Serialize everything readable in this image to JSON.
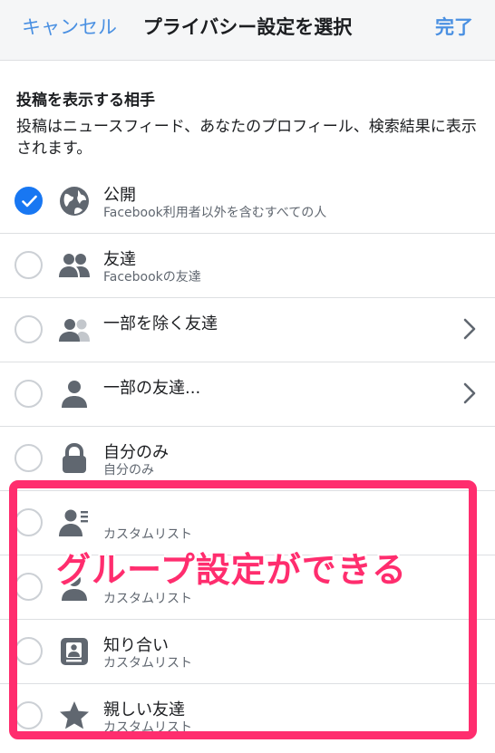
{
  "header": {
    "cancel_label": "キャンセル",
    "title": "プライバシー設定を選択",
    "done_label": "完了"
  },
  "section": {
    "title": "投稿を表示する相手",
    "description": "投稿はニュースフィード、あなたのプロフィール、検索結果に表示されます。"
  },
  "options": [
    {
      "label": "公開",
      "sub": "Facebook利用者以外を含むすべての人",
      "icon": "globe-icon",
      "checked": true
    },
    {
      "label": "友達",
      "sub": "Facebookの友達",
      "icon": "friends-icon",
      "checked": false
    },
    {
      "label": "一部を除く友達",
      "sub": "",
      "icon": "friends-except-icon",
      "checked": false,
      "chevron": true
    },
    {
      "label": "一部の友達...",
      "sub": "",
      "icon": "person-icon",
      "checked": false,
      "chevron": true
    },
    {
      "label": "自分のみ",
      "sub": "自分のみ",
      "icon": "lock-icon",
      "checked": false
    },
    {
      "label": "",
      "sub": "カスタムリスト",
      "icon": "list-person-icon",
      "checked": false
    },
    {
      "label": "",
      "sub": "カスタムリスト",
      "icon": "person-icon",
      "checked": false
    },
    {
      "label": "知り合い",
      "sub": "カスタムリスト",
      "icon": "badge-icon",
      "checked": false
    },
    {
      "label": "親しい友達",
      "sub": "カスタムリスト",
      "icon": "star-icon",
      "checked": false
    }
  ],
  "annotation": {
    "callout_text": "グループ設定ができる",
    "color": "#ff2d6e"
  },
  "colors": {
    "accent": "#1877f2",
    "link": "#4a90e2",
    "icon": "#606770"
  }
}
